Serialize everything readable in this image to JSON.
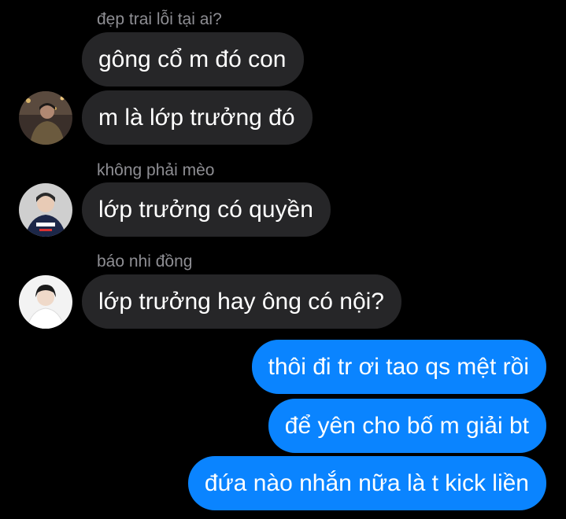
{
  "colors": {
    "background": "#000000",
    "incoming_bubble": "#262628",
    "outgoing_bubble": "#0a84ff",
    "sender_name": "#8e8e93",
    "text": "#ffffff"
  },
  "messages": [
    {
      "sender": "đẹp trai lỗi tại ai?",
      "text": "gông cổ m đó con",
      "direction": "incoming"
    },
    {
      "text": "m là lớp trưởng đó",
      "direction": "incoming",
      "avatar": "user-photo-icon"
    },
    {
      "sender": "không phải mèo",
      "text": "lớp trưởng có quyền",
      "direction": "incoming",
      "avatar": "user-photo-icon"
    },
    {
      "sender": "báo nhi đồng",
      "text": "lớp trưởng hay ông có nội?",
      "direction": "incoming",
      "avatar": "user-photo-icon"
    },
    {
      "text": "thôi đi tr ơi tao qs mệt rồi",
      "direction": "outgoing"
    },
    {
      "text": "để yên cho bố m giải bt",
      "direction": "outgoing"
    },
    {
      "text": "đứa nào nhắn nữa là t kick liền",
      "direction": "outgoing"
    }
  ]
}
